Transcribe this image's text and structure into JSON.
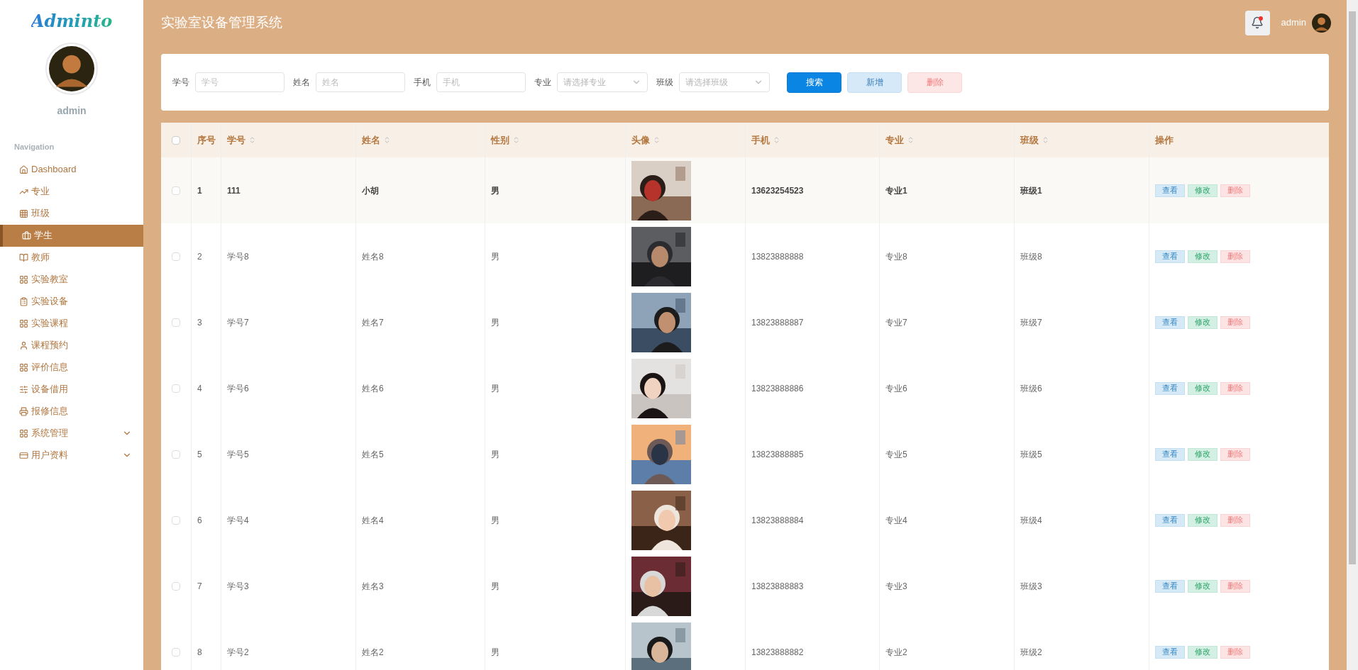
{
  "sidebar": {
    "logo": "Adminto",
    "user": "admin",
    "nav_heading": "Navigation",
    "items": [
      {
        "label": "Dashboard",
        "selected": false,
        "submenu": false
      },
      {
        "label": "专业",
        "selected": false,
        "submenu": false
      },
      {
        "label": "班级",
        "selected": false,
        "submenu": false
      },
      {
        "label": "学生",
        "selected": true,
        "submenu": false
      },
      {
        "label": "教师",
        "selected": false,
        "submenu": false
      },
      {
        "label": "实验教室",
        "selected": false,
        "submenu": false
      },
      {
        "label": "实验设备",
        "selected": false,
        "submenu": false
      },
      {
        "label": "实验课程",
        "selected": false,
        "submenu": false
      },
      {
        "label": "课程预约",
        "selected": false,
        "submenu": false
      },
      {
        "label": "评价信息",
        "selected": false,
        "submenu": false
      },
      {
        "label": "设备借用",
        "selected": false,
        "submenu": false
      },
      {
        "label": "报修信息",
        "selected": false,
        "submenu": false
      },
      {
        "label": "系统管理",
        "selected": false,
        "submenu": true
      },
      {
        "label": "用户资料",
        "selected": false,
        "submenu": true
      }
    ]
  },
  "header": {
    "title": "实验室设备管理系统",
    "notification": true,
    "user": "admin"
  },
  "filters": [
    {
      "kind": "input",
      "label": "学号",
      "placeholder": "学号"
    },
    {
      "kind": "input",
      "label": "姓名",
      "placeholder": "姓名"
    },
    {
      "kind": "input",
      "label": "手机",
      "placeholder": "手机"
    },
    {
      "kind": "select",
      "label": "专业",
      "placeholder": "请选择专业"
    },
    {
      "kind": "select",
      "label": "班级",
      "placeholder": "请选择班级"
    }
  ],
  "filter_buttons": [
    {
      "kind": "primary",
      "label": "搜索"
    },
    {
      "kind": "info",
      "label": "新增"
    },
    {
      "kind": "danger",
      "label": "删除"
    }
  ],
  "table": {
    "columns": [
      {
        "label": "序号",
        "sortable": false
      },
      {
        "label": "学号",
        "sortable": true
      },
      {
        "label": "姓名",
        "sortable": true
      },
      {
        "label": "性别",
        "sortable": true
      },
      {
        "label": "头像",
        "sortable": true
      },
      {
        "label": "手机",
        "sortable": true
      },
      {
        "label": "专业",
        "sortable": true
      },
      {
        "label": "班级",
        "sortable": true
      },
      {
        "label": "操作",
        "sortable": false
      }
    ],
    "header_checked": false,
    "rows": [
      {
        "checked": false,
        "highlighted": true,
        "cells": [
          "1",
          "111",
          "小胡",
          "男",
          "",
          "13623254523",
          "专业1",
          "班级1"
        ],
        "actions": [
          {
            "kind": "view",
            "label": "查看"
          },
          {
            "kind": "edit",
            "label": "修改"
          },
          {
            "kind": "delete",
            "label": "删除"
          }
        ]
      },
      {
        "checked": false,
        "highlighted": false,
        "cells": [
          "2",
          "学号8",
          "姓名8",
          "男",
          "",
          "13823888888",
          "专业8",
          "班级8"
        ],
        "actions": [
          {
            "kind": "view",
            "label": "查看"
          },
          {
            "kind": "edit",
            "label": "修改"
          },
          {
            "kind": "delete",
            "label": "删除"
          }
        ]
      },
      {
        "checked": false,
        "highlighted": false,
        "cells": [
          "3",
          "学号7",
          "姓名7",
          "男",
          "",
          "13823888887",
          "专业7",
          "班级7"
        ],
        "actions": [
          {
            "kind": "view",
            "label": "查看"
          },
          {
            "kind": "edit",
            "label": "修改"
          },
          {
            "kind": "delete",
            "label": "删除"
          }
        ]
      },
      {
        "checked": false,
        "highlighted": false,
        "cells": [
          "4",
          "学号6",
          "姓名6",
          "男",
          "",
          "13823888886",
          "专业6",
          "班级6"
        ],
        "actions": [
          {
            "kind": "view",
            "label": "查看"
          },
          {
            "kind": "edit",
            "label": "修改"
          },
          {
            "kind": "delete",
            "label": "删除"
          }
        ]
      },
      {
        "checked": false,
        "highlighted": false,
        "cells": [
          "5",
          "学号5",
          "姓名5",
          "男",
          "",
          "13823888885",
          "专业5",
          "班级5"
        ],
        "actions": [
          {
            "kind": "view",
            "label": "查看"
          },
          {
            "kind": "edit",
            "label": "修改"
          },
          {
            "kind": "delete",
            "label": "删除"
          }
        ]
      },
      {
        "checked": false,
        "highlighted": false,
        "cells": [
          "6",
          "学号4",
          "姓名4",
          "男",
          "",
          "13823888884",
          "专业4",
          "班级4"
        ],
        "actions": [
          {
            "kind": "view",
            "label": "查看"
          },
          {
            "kind": "edit",
            "label": "修改"
          },
          {
            "kind": "delete",
            "label": "删除"
          }
        ]
      },
      {
        "checked": false,
        "highlighted": false,
        "cells": [
          "7",
          "学号3",
          "姓名3",
          "男",
          "",
          "13823888883",
          "专业3",
          "班级3"
        ],
        "actions": [
          {
            "kind": "view",
            "label": "查看"
          },
          {
            "kind": "edit",
            "label": "修改"
          },
          {
            "kind": "delete",
            "label": "删除"
          }
        ]
      },
      {
        "checked": false,
        "highlighted": false,
        "cells": [
          "8",
          "学号2",
          "姓名2",
          "男",
          "",
          "13823888882",
          "专业2",
          "班级2"
        ],
        "actions": [
          {
            "kind": "view",
            "label": "查看"
          },
          {
            "kind": "edit",
            "label": "修改"
          },
          {
            "kind": "delete",
            "label": "删除"
          }
        ]
      }
    ]
  }
}
